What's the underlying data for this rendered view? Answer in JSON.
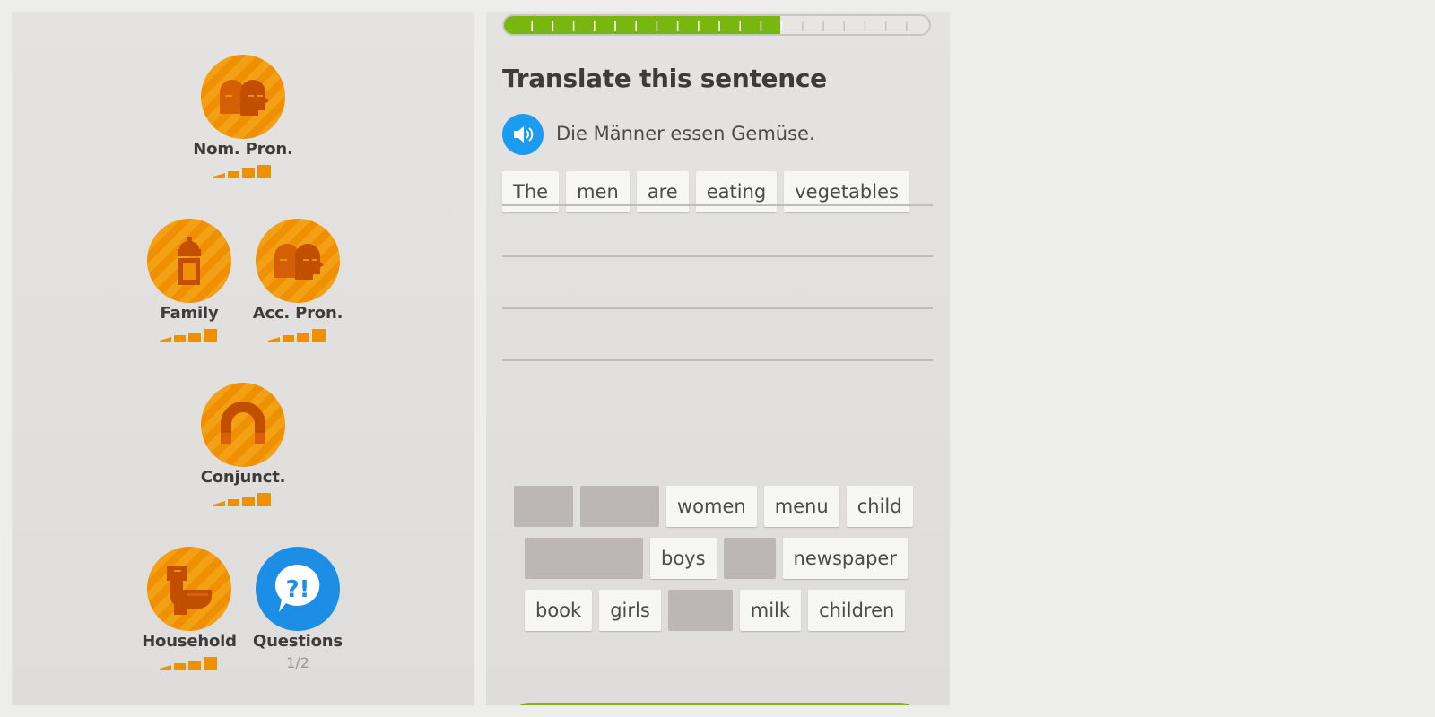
{
  "colors": {
    "skill_orange": "#ee9000",
    "skill_blue": "#1c8ee6",
    "progress_green": "#78b710",
    "speaker_blue": "#1c9cf0"
  },
  "skills": [
    {
      "id": "nom-pron",
      "label": "Nom. Pron.",
      "icon": "faces-icon",
      "strength_bars": 5
    },
    {
      "id": "family",
      "label": "Family",
      "icon": "baby-bottle-icon",
      "strength_bars": 5
    },
    {
      "id": "acc-pron",
      "label": "Acc. Pron.",
      "icon": "faces-icon",
      "strength_bars": 5
    },
    {
      "id": "conjunct",
      "label": "Conjunct.",
      "icon": "magnet-icon",
      "strength_bars": 5
    },
    {
      "id": "household",
      "label": "Household",
      "icon": "toilet-icon",
      "strength_bars": 5
    },
    {
      "id": "questions",
      "label": "Questions",
      "icon": "question-bubble-icon",
      "progress_text": "1/2"
    }
  ],
  "lesson": {
    "progress_fraction": 0.65,
    "progress_segments": 20,
    "title": "Translate this sentence",
    "speaker_icon": "speaker-icon",
    "source_sentence": "Die Männer essen Gemüse.",
    "answer_tokens": [
      "The",
      "men",
      "are",
      "eating",
      "vegetables"
    ],
    "bank_rows": [
      [
        "",
        "",
        "women",
        "menu",
        "child"
      ],
      [
        "",
        "boys",
        "",
        "newspaper"
      ],
      [
        "book",
        "girls",
        "",
        "milk",
        "children"
      ]
    ]
  }
}
